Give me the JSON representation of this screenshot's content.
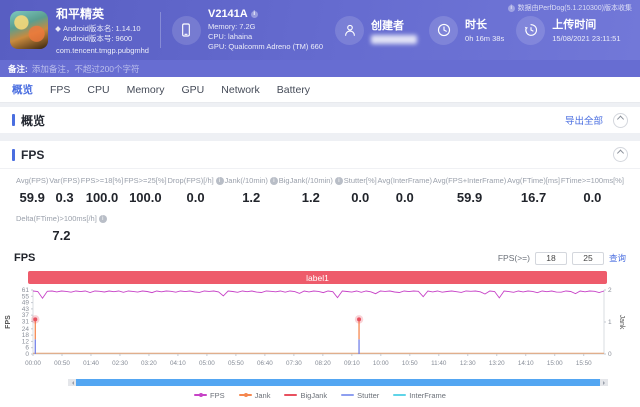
{
  "header": {
    "app": {
      "name": "和平精英",
      "version_name": "Android版本名: 1.14.10",
      "version_code": "Android版本号: 9600",
      "package": "com.tencent.tmgp.pubgmhd"
    },
    "device": {
      "model": "V2141A",
      "memory": "Memory: 7.2G",
      "cpu": "CPU: lahaina",
      "gpu": "GPU: Qualcomm Adreno (TM) 660"
    },
    "creator": {
      "label": "创建者"
    },
    "duration": {
      "label": "时长",
      "value": "0h 16m 38s"
    },
    "upload": {
      "label": "上传时间",
      "value": "15/08/2021 23:11:51"
    },
    "source_note": "数据由PerfDog(5.1.210300)版本收集"
  },
  "note_bar": {
    "label": "备注:",
    "placeholder": "添加备注，不超过200个字符"
  },
  "tabs": [
    {
      "key": "overview",
      "label": "概览",
      "active": true
    },
    {
      "key": "fps",
      "label": "FPS",
      "active": false
    },
    {
      "key": "cpu",
      "label": "CPU",
      "active": false
    },
    {
      "key": "memory",
      "label": "Memory",
      "active": false
    },
    {
      "key": "gpu",
      "label": "GPU",
      "active": false
    },
    {
      "key": "network",
      "label": "Network",
      "active": false
    },
    {
      "key": "battery",
      "label": "Battery",
      "active": false
    }
  ],
  "overview": {
    "title": "概览",
    "export_all": "导出全部"
  },
  "fps_panel": {
    "title": "FPS",
    "chart_title": "FPS",
    "filter": {
      "label": "FPS(>=)",
      "inputs": [
        "18",
        "25"
      ],
      "action": "查询"
    },
    "stats_row1": [
      {
        "key": "avg-fps",
        "label": "Avg(FPS)",
        "value": "59.9",
        "info": false
      },
      {
        "key": "var-fps",
        "label": "Var(FPS)",
        "value": "0.3",
        "info": false
      },
      {
        "key": "fps-ge-18",
        "label": "FPS>=18[%]",
        "value": "100.0",
        "info": false
      },
      {
        "key": "fps-ge-25",
        "label": "FPS>=25[%]",
        "value": "100.0",
        "info": false
      },
      {
        "key": "drop-fps",
        "label": "Drop(FPS)[/h]",
        "value": "0.0",
        "info": true
      },
      {
        "key": "jank",
        "label": "Jank(/10min)",
        "value": "1.2",
        "info": true
      },
      {
        "key": "bigjank",
        "label": "BigJank(/10min)",
        "value": "1.2",
        "info": true
      },
      {
        "key": "stutter",
        "label": "Stutter[%]",
        "value": "0.0",
        "info": false
      },
      {
        "key": "avg-interframe",
        "label": "Avg(InterFrame)",
        "value": "0.0",
        "info": false
      },
      {
        "key": "avg-fps-interframe",
        "label": "Avg(FPS+InterFrame)",
        "value": "59.9",
        "info": false
      },
      {
        "key": "avg-ftime",
        "label": "Avg(FTime)[ms]",
        "value": "16.7",
        "info": false
      },
      {
        "key": "ftime-ge-100ms",
        "label": "FTime>=100ms[%]",
        "value": "0.0",
        "info": false
      }
    ],
    "stats_row2": [
      {
        "key": "delta-ftime",
        "label": "Delta(FTime)>100ms[/h]",
        "value": "7.2",
        "info": true
      }
    ]
  },
  "colors": {
    "accent_blue": "#4a6ee0",
    "header_purple": "#5b61c6",
    "label_bar_red": "#ee5b6b",
    "scrollbar_blue": "#53a6f2"
  },
  "chart_data": {
    "type": "line",
    "title": "label1",
    "ylabel_left": "FPS",
    "ylabel_right": "Jank",
    "ylim_left": [
      0,
      61
    ],
    "ylim_right": [
      0,
      2
    ],
    "grid": false,
    "legend_position": "bottom",
    "y_left_ticks": [
      61,
      55,
      49,
      43,
      37,
      31,
      24,
      18,
      12,
      6,
      0
    ],
    "y_right_ticks": [
      2,
      1,
      0
    ],
    "x_ticks": [
      "00:00",
      "00:50",
      "01:40",
      "02:30",
      "03:20",
      "04:10",
      "05:00",
      "05:50",
      "06:40",
      "07:30",
      "08:20",
      "09:10",
      "10:00",
      "10:50",
      "11:40",
      "12:30",
      "13:20",
      "14:10",
      "15:00",
      "15:50"
    ],
    "series": [
      {
        "name": "FPS",
        "color": "#c743c7",
        "axis": "left",
        "values": [
          60,
          59.6,
          53.2,
          59.8,
          60,
          59.2,
          60,
          59.7,
          58.9,
          60,
          59.5,
          60,
          58.6,
          60,
          59.8,
          59.1,
          60,
          59.4,
          60,
          58.8,
          60,
          59.7,
          59,
          60,
          59.6,
          58.5,
          60,
          59.3,
          60,
          59.8,
          58.9,
          60,
          59.5,
          60,
          59.1,
          58.7,
          60,
          59.7,
          60,
          59.2,
          55.4,
          60,
          59.6,
          58.8,
          60,
          59.4,
          60,
          59,
          58.6,
          60,
          59.8,
          59.3,
          60,
          58.9,
          60,
          59.5,
          57.8,
          60,
          59.2,
          60,
          59.7,
          58.5,
          60,
          59.4,
          53.8,
          60,
          59.6,
          59,
          60,
          58.8,
          60,
          59.3,
          57.5,
          60,
          59.7,
          60,
          59.1,
          58.6,
          60,
          59.5,
          60,
          59.8,
          54.6,
          60,
          59.2,
          60,
          58.9,
          59.6,
          60,
          59.4,
          58.7,
          60,
          59.8,
          60,
          59.3,
          57.2,
          60,
          59.6,
          53.5,
          60,
          59.5,
          58.8,
          60,
          59.2,
          60,
          59.7,
          58.4,
          60,
          59.4,
          60,
          59,
          58.9,
          60,
          59.6,
          57.6,
          60,
          59.3,
          60,
          59.8,
          58.6,
          60
        ]
      },
      {
        "name": "Jank",
        "color": "#f5874f",
        "axis": "right",
        "events": [
          {
            "x": "00:00",
            "value": 1
          },
          {
            "x": "09:12",
            "value": 1
          }
        ]
      },
      {
        "name": "BigJank",
        "color": "#e8515f",
        "axis": "right",
        "events": [
          {
            "x": "00:00",
            "value": 1
          },
          {
            "x": "09:12",
            "value": 1
          }
        ]
      },
      {
        "name": "Stutter",
        "color": "#8e9ff0",
        "axis": "right",
        "constant_value": 0
      },
      {
        "name": "InterFrame",
        "color": "#5fd4e8",
        "axis": "left",
        "constant_value": 0
      }
    ],
    "events": [
      {
        "x_frac": 0.004,
        "top_fps": 33,
        "mid_fps": 14,
        "right_axis_value": 1
      },
      {
        "x_frac": 0.571,
        "top_fps": 33,
        "mid_fps": 14,
        "right_axis_value": 1
      }
    ],
    "legend": [
      {
        "name": "FPS",
        "color": "#c743c7",
        "marker": true
      },
      {
        "name": "Jank",
        "color": "#f5874f",
        "marker": true
      },
      {
        "name": "BigJank",
        "color": "#e8515f",
        "marker": false
      },
      {
        "name": "Stutter",
        "color": "#8e9ff0",
        "marker": false
      },
      {
        "name": "InterFrame",
        "color": "#5fd4e8",
        "marker": false
      }
    ]
  }
}
